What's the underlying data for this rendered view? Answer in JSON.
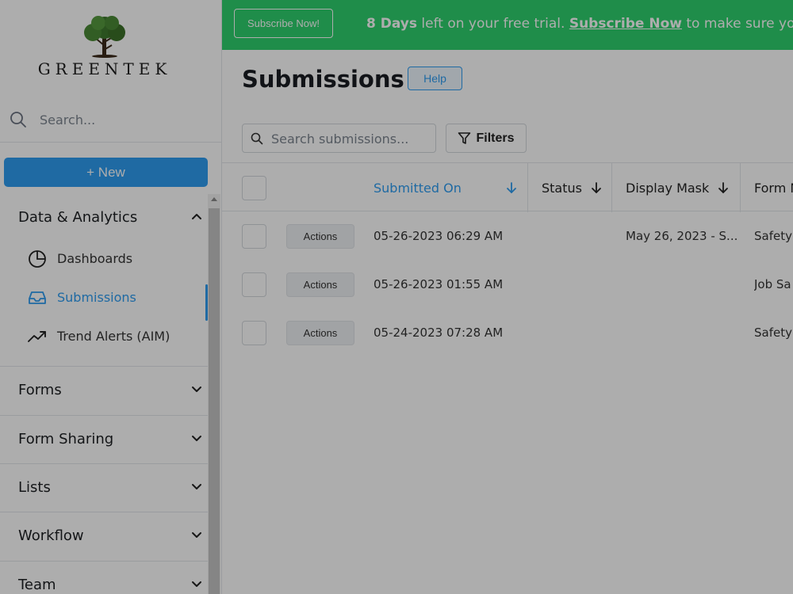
{
  "sidebar": {
    "logo_text": "GREENTEK",
    "search_placeholder": "Search...",
    "new_button": "+ New",
    "sections": {
      "data_analytics": {
        "label": "Data & Analytics",
        "items": [
          {
            "label": "Dashboards",
            "icon": "pie-chart-icon"
          },
          {
            "label": "Submissions",
            "icon": "inbox-icon",
            "active": true
          },
          {
            "label": "Trend Alerts (AIM)",
            "icon": "trending-up-icon"
          }
        ]
      },
      "forms": {
        "label": "Forms"
      },
      "form_sharing": {
        "label": "Form Sharing"
      },
      "lists": {
        "label": "Lists"
      },
      "workflow": {
        "label": "Workflow"
      },
      "team": {
        "label": "Team"
      }
    }
  },
  "banner": {
    "subscribe_button": "Subscribe Now!",
    "days": "8 Days",
    "msg_mid": " left on your free trial. ",
    "link": "Subscribe Now",
    "msg_end": " to make sure you c"
  },
  "main": {
    "title": "Submissions",
    "help_button": "Help",
    "search_placeholder": "Search submissions...",
    "filters_button": "Filters"
  },
  "table": {
    "columns": {
      "submitted_on": "Submitted On",
      "status": "Status",
      "display_mask": "Display Mask",
      "form_name": "Form N"
    },
    "action_label": "Actions",
    "rows": [
      {
        "submitted_on": "05-26-2023 06:29 AM",
        "status": "",
        "display_mask": "May 26, 2023 - S...",
        "form_name": "Safety"
      },
      {
        "submitted_on": "05-26-2023 01:55 AM",
        "status": "",
        "display_mask": "",
        "form_name": "Job Sa"
      },
      {
        "submitted_on": "05-24-2023 07:28 AM",
        "status": "",
        "display_mask": "",
        "form_name": "Safety"
      }
    ]
  },
  "colors": {
    "accent": "#2e9cf0",
    "banner": "#2fd06e",
    "overlay": "rgba(0,0,0,0.32)"
  }
}
